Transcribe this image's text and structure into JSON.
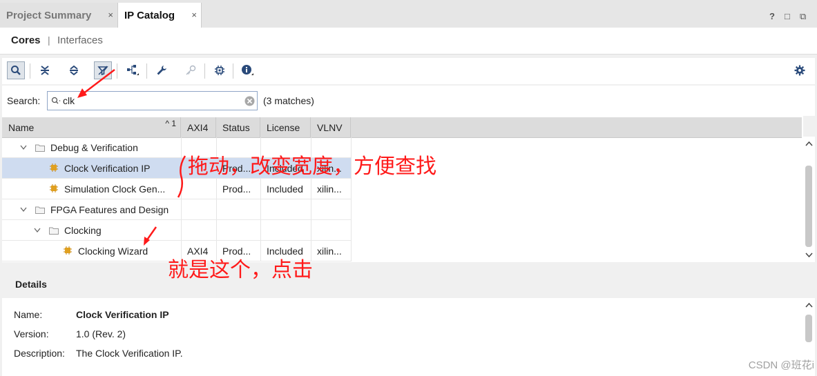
{
  "tabs": [
    {
      "label": "Project Summary"
    },
    {
      "label": "IP Catalog"
    }
  ],
  "tab_close": "×",
  "window_icons": {
    "help": "?",
    "restore": "□",
    "float": "⧉"
  },
  "subtabs": {
    "cores": "Cores",
    "divider": "|",
    "interfaces": "Interfaces"
  },
  "toolbar": {
    "icons": [
      "search-icon",
      "collapse-all-icon",
      "expand-all-icon",
      "filter-icon",
      "hierarchy-icon",
      "wrench-icon",
      "key-icon",
      "chip-icon",
      "info-icon",
      "gear-icon"
    ]
  },
  "search": {
    "label": "Search:",
    "value": "clk",
    "matches": "(3 matches)"
  },
  "table": {
    "columns": [
      "Name",
      "AXI4",
      "Status",
      "License",
      "VLNV"
    ],
    "sort_indicator": "^ 1",
    "rows": [
      {
        "level": 1,
        "type": "folder",
        "name": "Debug & Verification",
        "axi4": "",
        "status": "",
        "license": "",
        "vlnv": ""
      },
      {
        "level": 2,
        "type": "ip",
        "name": "Clock Verification IP",
        "axi4": "",
        "status": "Prod...",
        "license": "Included",
        "vlnv": "xilin...",
        "selected": true
      },
      {
        "level": 2,
        "type": "ip",
        "name": "Simulation Clock Gen...",
        "axi4": "",
        "status": "Prod...",
        "license": "Included",
        "vlnv": "xilin..."
      },
      {
        "level": 1,
        "type": "folder",
        "name": "FPGA Features and Design",
        "axi4": "",
        "status": "",
        "license": "",
        "vlnv": ""
      },
      {
        "level": 2,
        "type": "folder",
        "name": "Clocking",
        "axi4": "",
        "status": "",
        "license": "",
        "vlnv": ""
      },
      {
        "level": 3,
        "type": "ip",
        "name": "Clocking Wizard",
        "axi4": "AXI4",
        "status": "Prod...",
        "license": "Included",
        "vlnv": "xilin..."
      }
    ]
  },
  "details": {
    "title": "Details",
    "fields": [
      {
        "label": "Name:",
        "value": "Clock Verification IP",
        "bold": true
      },
      {
        "label": "Version:",
        "value": "1.0 (Rev. 2)"
      },
      {
        "label": "Description:",
        "value": "The Clock Verification IP."
      }
    ]
  },
  "annotations": {
    "drag_note": "拖动，改变宽度，方便查找",
    "click_note": "就是这个，点击"
  },
  "watermark": "CSDN @班花i",
  "colors": {
    "selection": "#cfdcf0",
    "annotation": "#ff1a1a",
    "ip_icon": "#e0a020"
  }
}
